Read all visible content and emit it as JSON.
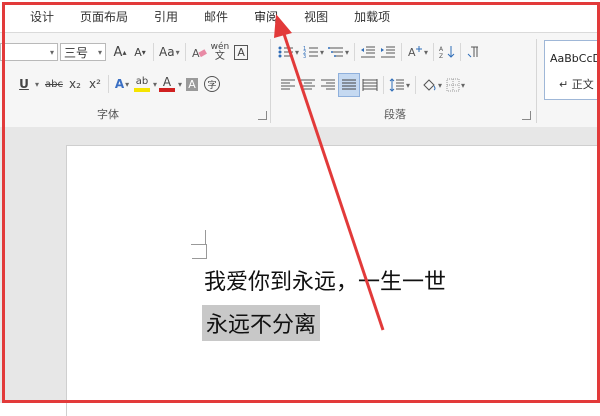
{
  "tabs": [
    "设计",
    "页面布局",
    "引用",
    "邮件",
    "审阅",
    "视图",
    "加载项"
  ],
  "font": {
    "size_value": "三号",
    "grow_label": "A",
    "shrink_label": "A",
    "case_label": "Aa",
    "pinyin_top": "wén",
    "pinyin_bottom": "文",
    "border_char": "A",
    "underline": "U",
    "strike": "abc",
    "sub": "x₂",
    "sup": "x²",
    "effect": "A",
    "highlight": "ab",
    "color": "A",
    "shade": "A",
    "enclose": "字",
    "group_label": "字体"
  },
  "paragraph": {
    "group_label": "段落"
  },
  "styles": {
    "preview": "AaBbCcD",
    "name": "↵ 正文"
  },
  "document": {
    "line1": "我爱你到永远，一生一世",
    "line2": "永远不分离"
  },
  "colors": {
    "annotation": "#e23a3a",
    "highlight_yellow": "#f5e400",
    "font_red": "#d02020"
  }
}
